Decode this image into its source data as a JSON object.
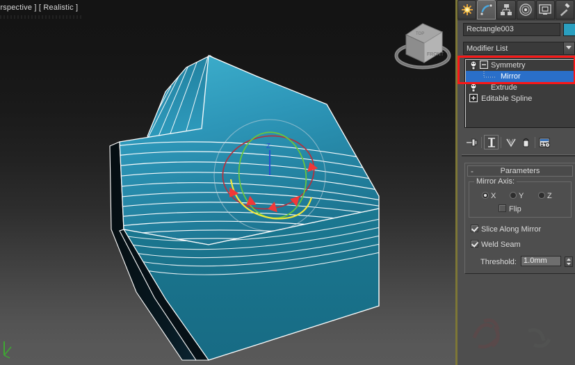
{
  "viewport": {
    "label": "erspective ] [ Realistic ]",
    "viewcube_front_text": "FRONT",
    "viewcube_top_text": "TOP",
    "gizmo": {
      "z_axis_label": "Z",
      "x_ring_color": "#b5303d",
      "y_ring_color": "#6cc83a",
      "z_axis_color": "#2b4fd4",
      "highlight_color": "#f4e83a",
      "arrow_color": "#f03838"
    },
    "mesh": {
      "face_color": "#2b95b6",
      "face_shadow_color": "#0b1f27",
      "wire_color": "#ffffff",
      "side_color": "#1f6e86"
    }
  },
  "command_panel": {
    "tabs": [
      {
        "name": "create-tab",
        "label": "Create",
        "icon": "star-icon",
        "active": false
      },
      {
        "name": "modify-tab",
        "label": "Modify",
        "icon": "curve-icon",
        "active": true
      },
      {
        "name": "hierarchy-tab",
        "label": "Hierarchy",
        "icon": "hierarchy-icon",
        "active": false
      },
      {
        "name": "motion-tab",
        "label": "Motion",
        "icon": "motion-icon",
        "active": false
      },
      {
        "name": "display-tab",
        "label": "Display",
        "icon": "monitor-icon",
        "active": false
      },
      {
        "name": "utilities-tab",
        "label": "Utilities",
        "icon": "hammer-icon",
        "active": false
      }
    ],
    "object_name": "Rectangle003",
    "object_color": "#2a9fc0",
    "modifier_list_label": "Modifier List",
    "stack": [
      {
        "label": "Symmetry",
        "icon": "lightbulb-icon",
        "toggle": "minus-box",
        "indent": 30,
        "selected": false
      },
      {
        "label": "Mirror",
        "icon": "none",
        "toggle": "none",
        "indent": 50,
        "selected": true
      },
      {
        "label": "Extrude",
        "icon": "lightbulb-icon",
        "toggle": "none",
        "indent": 30,
        "selected": false
      },
      {
        "label": "Editable Spline",
        "icon": "none",
        "toggle": "plus-box",
        "indent": 18,
        "selected": false
      }
    ],
    "stack_toolbar": [
      {
        "name": "pin-stack-button",
        "icon": "pin-icon",
        "active": false
      },
      {
        "name": "show-end-result-button",
        "icon": "show-result-icon",
        "active": true
      },
      {
        "name": "make-unique-button",
        "icon": "make-unique-icon",
        "active": false
      },
      {
        "name": "remove-modifier-button",
        "icon": "trash-icon",
        "active": false
      },
      {
        "name": "configure-sets-button",
        "icon": "configure-icon",
        "active": false
      }
    ],
    "parameters": {
      "title": "Parameters",
      "collapse_glyph": "-",
      "mirror_axis_title": "Mirror Axis:",
      "axis_options": [
        {
          "label": "X",
          "selected": true
        },
        {
          "label": "Y",
          "selected": false
        },
        {
          "label": "Z",
          "selected": false
        }
      ],
      "flip_label": "Flip",
      "flip_checked": false,
      "slice_label": "Slice Along Mirror",
      "slice_checked": true,
      "weld_label": "Weld Seam",
      "weld_checked": true,
      "threshold_label": "Threshold:",
      "threshold_value": "1.0mm"
    }
  },
  "colors": {
    "annotation_red": "#fb1616",
    "selection_blue": "#2a6fc9",
    "panel_bg": "#4e4e4e",
    "divider_olive": "#7d7736"
  }
}
